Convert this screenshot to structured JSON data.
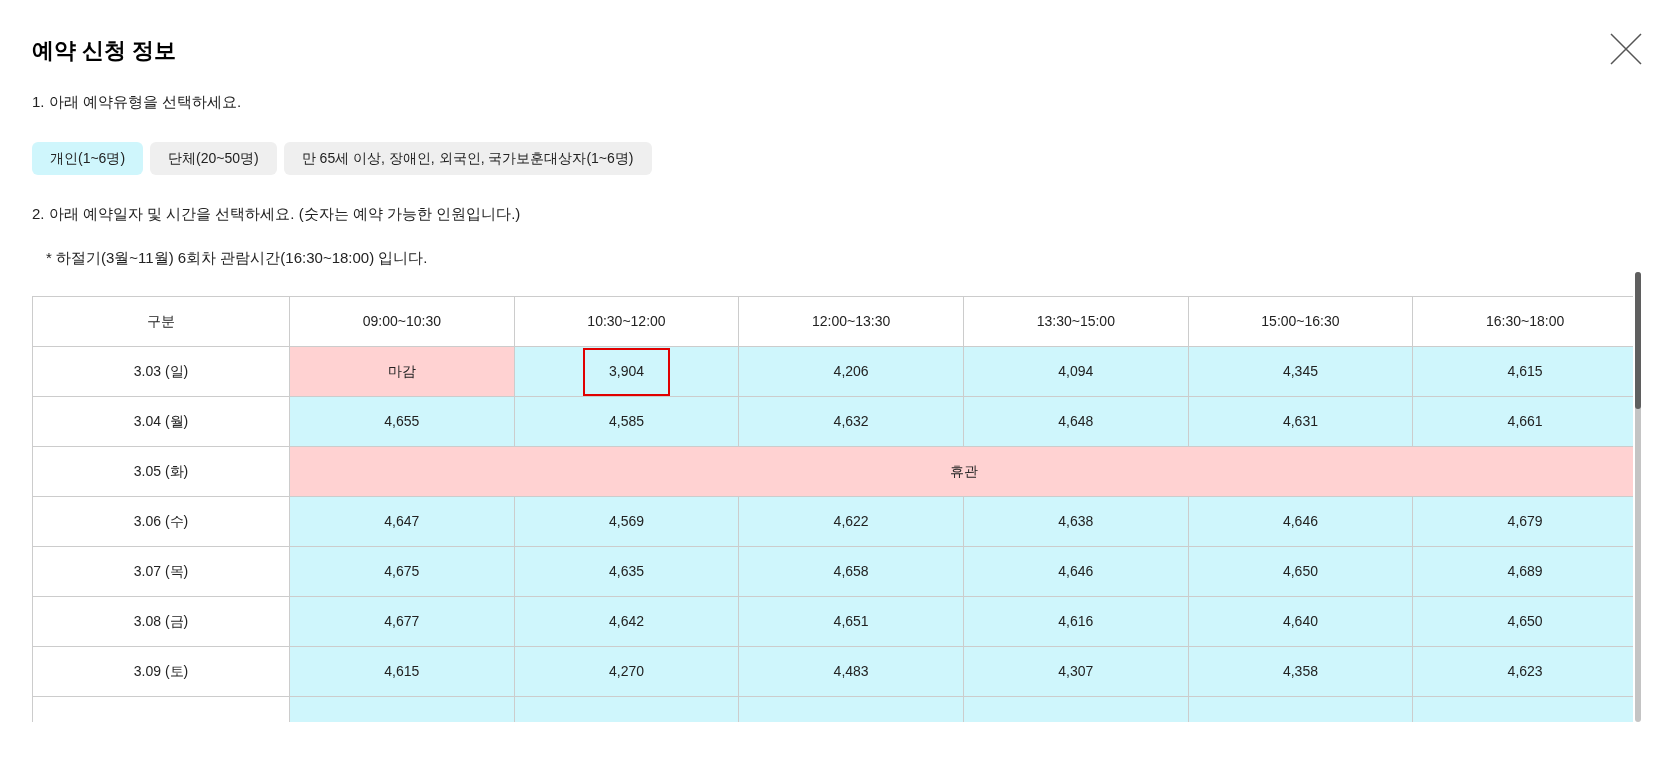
{
  "title": "예약 신청 정보",
  "step1": "1. 아래 예약유형을 선택하세요.",
  "types": [
    {
      "label": "개인(1~6명)",
      "selected": true
    },
    {
      "label": "단체(20~50명)",
      "selected": false
    },
    {
      "label": "만 65세 이상, 장애인, 외국인, 국가보훈대상자(1~6명)",
      "selected": false
    }
  ],
  "step2": "2. 아래 예약일자 및 시간을 선택하세요. (숫자는 예약 가능한 인원입니다.)",
  "note": "* 하절기(3월~11월) 6회차 관람시간(16:30~18:00) 입니다.",
  "table": {
    "columns": [
      "구분",
      "09:00~10:30",
      "10:30~12:00",
      "12:00~13:30",
      "13:30~15:00",
      "15:00~16:30",
      "16:30~18:00"
    ],
    "rows": [
      {
        "date": "3.03 (일)",
        "slots": [
          {
            "kind": "closed",
            "text": "마감",
            "selected": false
          },
          {
            "kind": "open",
            "text": "3,904",
            "selected": true
          },
          {
            "kind": "open",
            "text": "4,206",
            "selected": false
          },
          {
            "kind": "open",
            "text": "4,094",
            "selected": false
          },
          {
            "kind": "open",
            "text": "4,345",
            "selected": false
          },
          {
            "kind": "open",
            "text": "4,615",
            "selected": false
          }
        ]
      },
      {
        "date": "3.04 (월)",
        "slots": [
          {
            "kind": "open",
            "text": "4,655",
            "selected": false
          },
          {
            "kind": "open",
            "text": "4,585",
            "selected": false
          },
          {
            "kind": "open",
            "text": "4,632",
            "selected": false
          },
          {
            "kind": "open",
            "text": "4,648",
            "selected": false
          },
          {
            "kind": "open",
            "text": "4,631",
            "selected": false
          },
          {
            "kind": "open",
            "text": "4,661",
            "selected": false
          }
        ]
      },
      {
        "date": "3.05 (화)",
        "slots": [
          {
            "kind": "holiday",
            "text": "휴관",
            "selected": false
          }
        ]
      },
      {
        "date": "3.06 (수)",
        "slots": [
          {
            "kind": "open",
            "text": "4,647",
            "selected": false
          },
          {
            "kind": "open",
            "text": "4,569",
            "selected": false
          },
          {
            "kind": "open",
            "text": "4,622",
            "selected": false
          },
          {
            "kind": "open",
            "text": "4,638",
            "selected": false
          },
          {
            "kind": "open",
            "text": "4,646",
            "selected": false
          },
          {
            "kind": "open",
            "text": "4,679",
            "selected": false
          }
        ]
      },
      {
        "date": "3.07 (목)",
        "slots": [
          {
            "kind": "open",
            "text": "4,675",
            "selected": false
          },
          {
            "kind": "open",
            "text": "4,635",
            "selected": false
          },
          {
            "kind": "open",
            "text": "4,658",
            "selected": false
          },
          {
            "kind": "open",
            "text": "4,646",
            "selected": false
          },
          {
            "kind": "open",
            "text": "4,650",
            "selected": false
          },
          {
            "kind": "open",
            "text": "4,689",
            "selected": false
          }
        ]
      },
      {
        "date": "3.08 (금)",
        "slots": [
          {
            "kind": "open",
            "text": "4,677",
            "selected": false
          },
          {
            "kind": "open",
            "text": "4,642",
            "selected": false
          },
          {
            "kind": "open",
            "text": "4,651",
            "selected": false
          },
          {
            "kind": "open",
            "text": "4,616",
            "selected": false
          },
          {
            "kind": "open",
            "text": "4,640",
            "selected": false
          },
          {
            "kind": "open",
            "text": "4,650",
            "selected": false
          }
        ]
      },
      {
        "date": "3.09 (토)",
        "slots": [
          {
            "kind": "open",
            "text": "4,615",
            "selected": false
          },
          {
            "kind": "open",
            "text": "4,270",
            "selected": false
          },
          {
            "kind": "open",
            "text": "4,483",
            "selected": false
          },
          {
            "kind": "open",
            "text": "4,307",
            "selected": false
          },
          {
            "kind": "open",
            "text": "4,358",
            "selected": false
          },
          {
            "kind": "open",
            "text": "4,623",
            "selected": false
          }
        ]
      },
      {
        "slots": [
          {
            "kind": "open"
          },
          {
            "kind": "open"
          },
          {
            "kind": "open"
          },
          {
            "kind": "open"
          },
          {
            "kind": "open"
          },
          {
            "kind": "open"
          }
        ]
      }
    ]
  }
}
